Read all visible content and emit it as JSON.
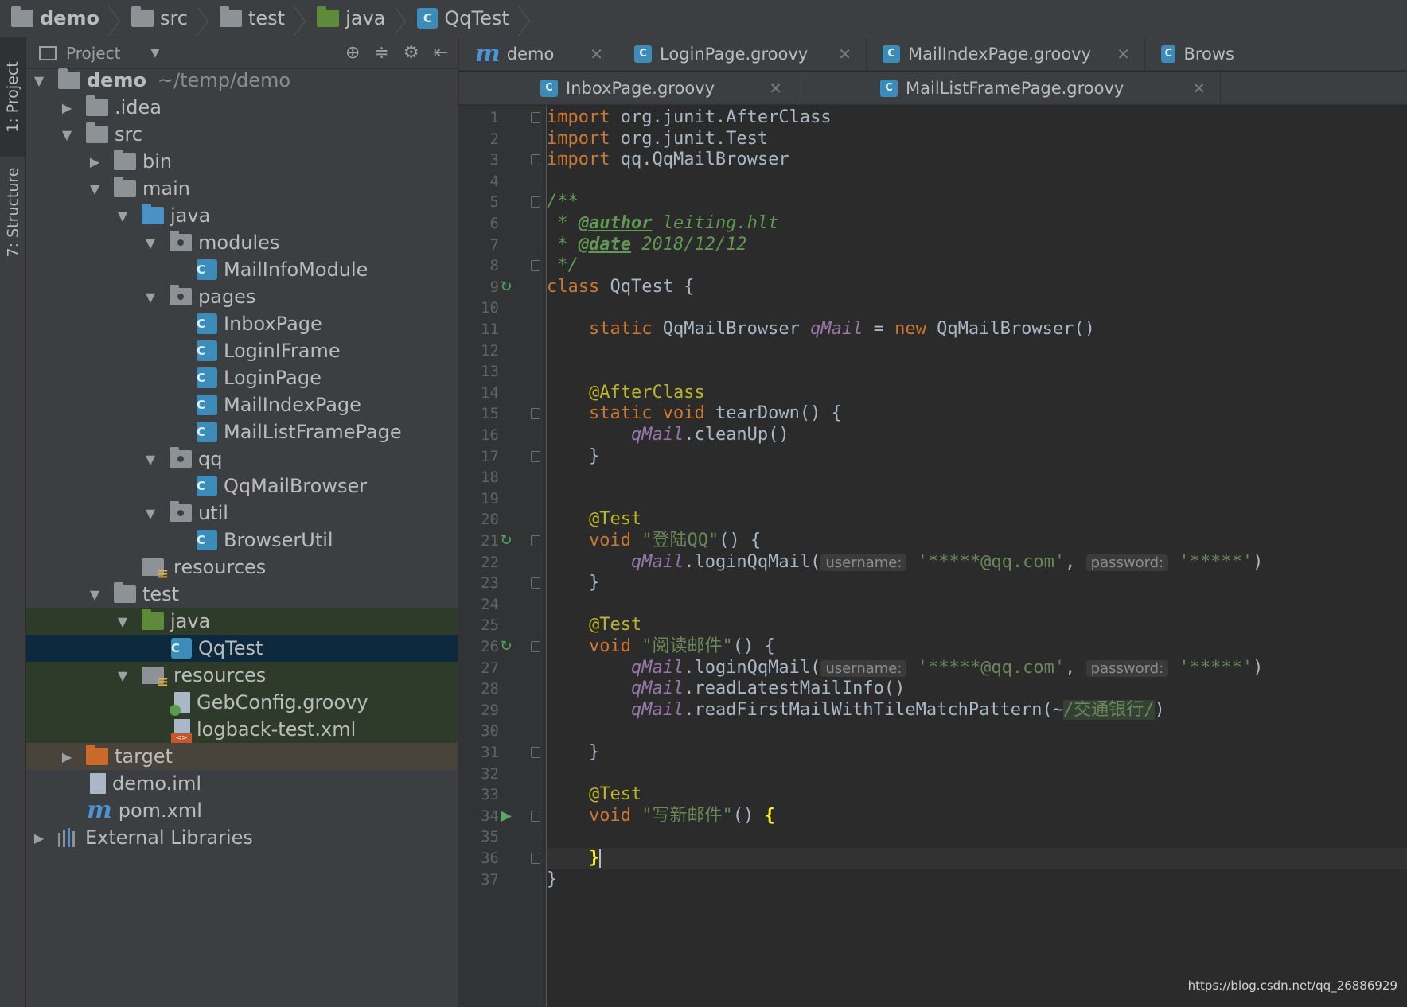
{
  "breadcrumb": [
    {
      "label": "demo",
      "icon": "module-folder-icon"
    },
    {
      "label": "src",
      "icon": "folder-icon"
    },
    {
      "label": "test",
      "icon": "folder-icon"
    },
    {
      "label": "java",
      "icon": "test-source-folder-icon"
    },
    {
      "label": "QqTest",
      "icon": "groovy-class-icon"
    }
  ],
  "toolstrip": {
    "project_tab": "1: Project",
    "structure_tab": "7: Structure"
  },
  "project_panel": {
    "title": "Project",
    "tree": [
      {
        "label": "demo",
        "suffix": "~/temp/demo",
        "arrow": "▼",
        "icon": "module"
      },
      {
        "label": ".idea",
        "arrow": "▶",
        "icon": "folder"
      },
      {
        "label": "src",
        "arrow": "▼",
        "icon": "folder"
      },
      {
        "label": "bin",
        "arrow": "▶",
        "icon": "folder"
      },
      {
        "label": "main",
        "arrow": "▼",
        "icon": "folder"
      },
      {
        "label": "java",
        "arrow": "▼",
        "icon": "src-folder"
      },
      {
        "label": "modules",
        "arrow": "▼",
        "icon": "package"
      },
      {
        "label": "MailInfoModule",
        "arrow": "",
        "icon": "class"
      },
      {
        "label": "pages",
        "arrow": "▼",
        "icon": "package"
      },
      {
        "label": "InboxPage",
        "arrow": "",
        "icon": "class"
      },
      {
        "label": "LoginIFrame",
        "arrow": "",
        "icon": "class"
      },
      {
        "label": "LoginPage",
        "arrow": "",
        "icon": "class"
      },
      {
        "label": "MailIndexPage",
        "arrow": "",
        "icon": "class"
      },
      {
        "label": "MailListFramePage",
        "arrow": "",
        "icon": "class"
      },
      {
        "label": "qq",
        "arrow": "▼",
        "icon": "package"
      },
      {
        "label": "QqMailBrowser",
        "arrow": "",
        "icon": "class"
      },
      {
        "label": "util",
        "arrow": "▼",
        "icon": "package"
      },
      {
        "label": "BrowserUtil",
        "arrow": "",
        "icon": "class"
      },
      {
        "label": "resources",
        "arrow": "",
        "icon": "resources"
      },
      {
        "label": "test",
        "arrow": "▼",
        "icon": "folder"
      },
      {
        "label": "java",
        "arrow": "▼",
        "icon": "test-folder"
      },
      {
        "label": "QqTest",
        "arrow": "",
        "icon": "class"
      },
      {
        "label": "resources",
        "arrow": "▼",
        "icon": "resources"
      },
      {
        "label": "GebConfig.groovy",
        "arrow": "",
        "icon": "groovy-file"
      },
      {
        "label": "logback-test.xml",
        "arrow": "",
        "icon": "xml-file"
      },
      {
        "label": "target",
        "arrow": "▶",
        "icon": "excluded-folder"
      },
      {
        "label": "demo.iml",
        "arrow": "",
        "icon": "iml-file"
      },
      {
        "label": "pom.xml",
        "arrow": "",
        "icon": "maven"
      },
      {
        "label": "External Libraries",
        "arrow": "▶",
        "icon": "libraries"
      }
    ]
  },
  "editor": {
    "tabs_row1": [
      {
        "label": "demo",
        "icon": "maven-icon"
      },
      {
        "label": "LoginPage.groovy",
        "icon": "groovy-class-icon"
      },
      {
        "label": "MailIndexPage.groovy",
        "icon": "groovy-class-icon"
      },
      {
        "label": "Brows",
        "icon": "groovy-class-icon"
      }
    ],
    "tabs_row2": [
      {
        "label": "InboxPage.groovy",
        "icon": "groovy-class-icon"
      },
      {
        "label": "MailListFramePage.groovy",
        "icon": "groovy-class-icon"
      }
    ],
    "line_numbers": [
      "1",
      "2",
      "3",
      "4",
      "5",
      "6",
      "7",
      "8",
      "9",
      "10",
      "11",
      "12",
      "13",
      "14",
      "15",
      "16",
      "17",
      "18",
      "19",
      "20",
      "21",
      "22",
      "23",
      "24",
      "25",
      "26",
      "27",
      "28",
      "29",
      "30",
      "31",
      "32",
      "33",
      "34",
      "35",
      "36",
      "37"
    ],
    "code": {
      "l1": [
        "import",
        " org.junit.AfterClass"
      ],
      "l2": [
        "import",
        " org.junit.Test"
      ],
      "l3": [
        "import",
        " qq.QqMailBrowser"
      ],
      "l5": "/**",
      "l6": [
        " * ",
        "@author",
        " leiting.hlt"
      ],
      "l7": [
        " * ",
        "@date",
        " 2018/12/12"
      ],
      "l8": " */",
      "l9": [
        "class",
        " QqTest {"
      ],
      "l11": [
        "    ",
        "static",
        " QqMailBrowser ",
        "qMail",
        " = ",
        "new",
        " QqMailBrowser()"
      ],
      "l14": "    @AfterClass",
      "l15": [
        "    ",
        "static",
        " ",
        "void",
        " tearDown() {"
      ],
      "l16": [
        "        ",
        "qMail",
        ".cleanUp()"
      ],
      "l17": "    }",
      "l20": "    @Test",
      "l21": [
        "    ",
        "void",
        " ",
        "\"登陆QQ\"",
        "() {"
      ],
      "l22": [
        "        ",
        "qMail",
        ".loginQqMail(",
        "username:",
        "'*****@qq.com'",
        ", ",
        "password:",
        "'*****'",
        ")"
      ],
      "l23": "    }",
      "l25": "    @Test",
      "l26": [
        "    ",
        "void",
        " ",
        "\"阅读邮件\"",
        "() {"
      ],
      "l27": [
        "        ",
        "qMail",
        ".loginQqMail(",
        "username:",
        "'*****@qq.com'",
        ", ",
        "password:",
        "'*****'",
        ")"
      ],
      "l28": [
        "        ",
        "qMail",
        ".readLatestMailInfo()"
      ],
      "l29": [
        "        ",
        "qMail",
        ".readFirstMailWithTileMatchPattern(~",
        "/交通银行/",
        ")"
      ],
      "l31": "    }",
      "l33": "    @Test",
      "l34": [
        "    ",
        "void",
        " ",
        "\"写新邮件\"",
        "() ",
        "{"
      ],
      "l36": [
        "    ",
        "}"
      ],
      "l37": "}"
    }
  },
  "watermark": "https://blog.csdn.net/qq_26886929",
  "colors": {
    "background": "#2b2b2b",
    "keyword": "#cc7832",
    "annotation": "#bbb529",
    "string": "#6a8759",
    "field": "#9876aa",
    "comment": "#629755",
    "selection": "#0d293e"
  }
}
